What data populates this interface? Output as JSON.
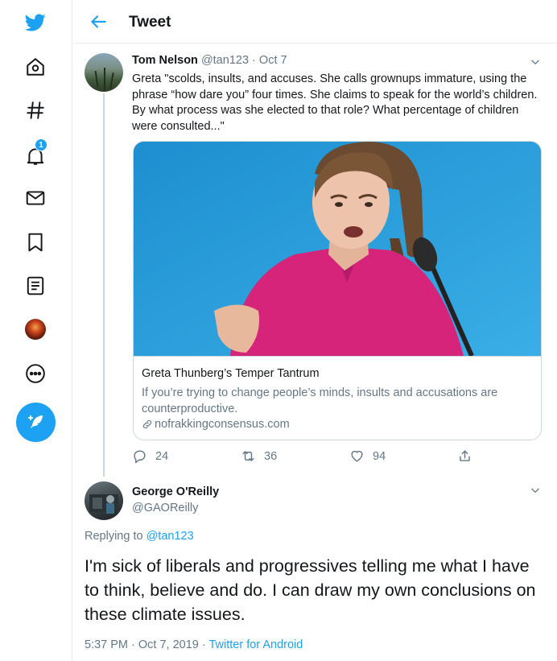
{
  "sidebar": {
    "items": [
      {
        "name": "twitter-logo"
      },
      {
        "name": "home-icon"
      },
      {
        "name": "explore-icon"
      },
      {
        "name": "notifications-icon",
        "badge": "1"
      },
      {
        "name": "messages-icon"
      },
      {
        "name": "bookmarks-icon"
      },
      {
        "name": "lists-icon"
      },
      {
        "name": "profile-avatar"
      },
      {
        "name": "more-icon"
      },
      {
        "name": "compose-tweet-button"
      }
    ],
    "accent": "#1da1f2"
  },
  "header": {
    "title": "Tweet"
  },
  "quoted_tweet": {
    "display_name": "Tom Nelson",
    "handle": "@tan123",
    "separator": "·",
    "date": "Oct 7",
    "text": "Greta \"scolds, insults, and accuses. She calls grownups immature, using the phrase “how dare you” four times.  She claims to speak for the world’s children. By what process was she elected to that role? What percentage of children were consulted...\"",
    "card": {
      "title": "Greta Thunberg’s Temper Tantrum",
      "description": "If you’re trying to change people’s minds, insults and accusations are counterproductive.",
      "domain": "nofrakkingconsensus.com"
    },
    "actions": {
      "replies": "24",
      "retweets": "36",
      "likes": "94"
    }
  },
  "main_tweet": {
    "display_name": "George O'Reilly",
    "handle": "@GAOReilly",
    "replying_prefix": "Replying to",
    "replying_to": "@tan123",
    "text": "I'm sick of liberals and progressives telling me what I have to think, believe and do. I can draw my own conclusions on these climate issues.",
    "timestamp": "5:37 PM · Oct 7, 2019",
    "meta_separator": " · ",
    "source": "Twitter for Android"
  }
}
